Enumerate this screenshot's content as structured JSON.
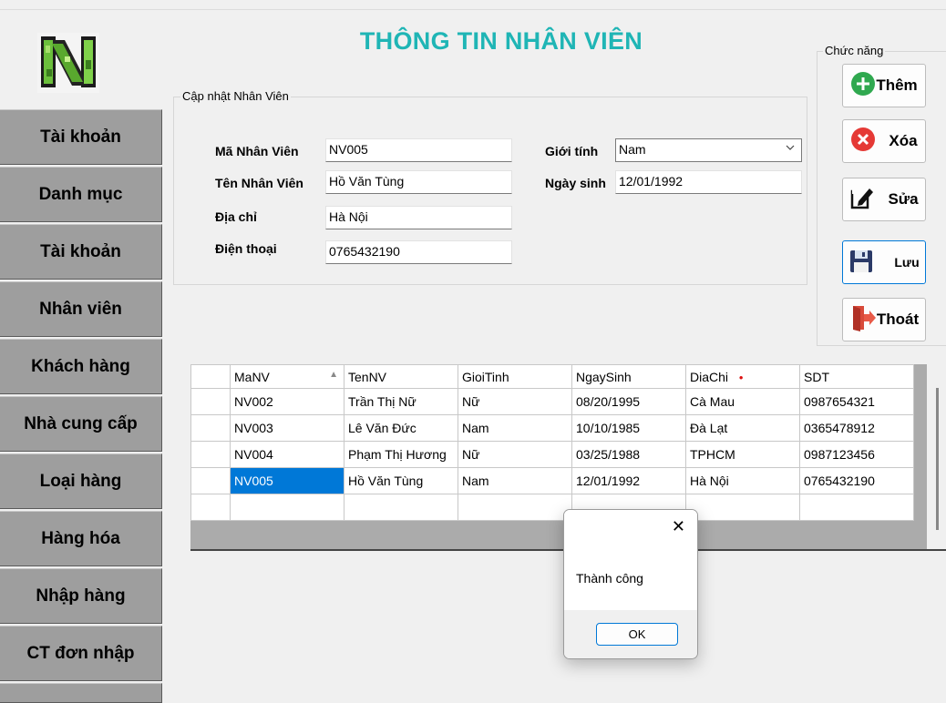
{
  "page_title": "THÔNG TIN NHÂN VIÊN",
  "sidebar": {
    "items": [
      {
        "label": "Tài khoản"
      },
      {
        "label": "Danh mục"
      },
      {
        "label": "Tài khoản"
      },
      {
        "label": "Nhân viên"
      },
      {
        "label": "Khách hàng"
      },
      {
        "label": "Nhà cung cấp"
      },
      {
        "label": "Loại hàng"
      },
      {
        "label": "Hàng hóa"
      },
      {
        "label": "Nhập hàng"
      },
      {
        "label": "CT đơn nhập"
      }
    ]
  },
  "form": {
    "group_title": "Cập nhật Nhân Viên",
    "ma_nv_label": "Mã Nhân Viên",
    "ma_nv_value": "NV005",
    "ten_nv_label": "Tên Nhân Viên",
    "ten_nv_value": "Hồ Văn Tùng",
    "dia_chi_label": "Địa chỉ",
    "dia_chi_value": "Hà Nội",
    "dien_thoai_label": "Điện thoại",
    "dien_thoai_value": "0765432190",
    "gioi_tinh_label": "Giới tính",
    "gioi_tinh_value": "Nam",
    "ngay_sinh_label": "Ngày sinh",
    "ngay_sinh_value": "12/01/1992"
  },
  "actions": {
    "group_title": "Chức năng",
    "them_label": "Thêm",
    "xoa_label": "Xóa",
    "sua_label": "Sửa",
    "luu_label": "Lưu",
    "thoat_label": "Thoát"
  },
  "grid": {
    "columns": [
      "MaNV",
      "TenNV",
      "GioiTinh",
      "NgaySinh",
      "DiaChi",
      "SDT"
    ],
    "sort_column": "MaNV",
    "rows": [
      [
        "NV002",
        "Trần Thị Nữ",
        "Nữ",
        "08/20/1995",
        "Cà Mau",
        "0987654321"
      ],
      [
        "NV003",
        "Lê Văn Đức",
        "Nam",
        "10/10/1985",
        "Đà Lạt",
        "0365478912"
      ],
      [
        "NV004",
        "Phạm Thị Hương",
        "Nữ",
        "03/25/1988",
        "TPHCM",
        "0987123456"
      ],
      [
        "NV005",
        "Hồ Văn Tùng",
        "Nam",
        "12/01/1992",
        "Hà Nội",
        "0765432190"
      ]
    ],
    "selected_row": 3,
    "selected_column": 0
  },
  "dialog": {
    "message": "Thành công",
    "ok_label": "OK",
    "close_symbol": "✕"
  },
  "colors": {
    "title": "#1fb5b5",
    "sidebar_button": "#9e9e9e",
    "selection": "#0078d7"
  }
}
